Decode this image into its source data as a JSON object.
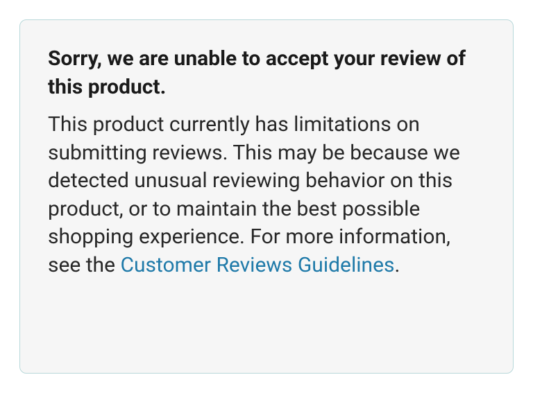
{
  "alert": {
    "heading": "Sorry, we are unable to accept your review of this product.",
    "body_before_link": "This product currently has limitations on submitting reviews. This may be because we detected unusual reviewing behavior on this product, or to maintain the best possible shopping experience. For more information, see the ",
    "link_text": "Customer Reviews Guidelines",
    "body_after_link": "."
  }
}
